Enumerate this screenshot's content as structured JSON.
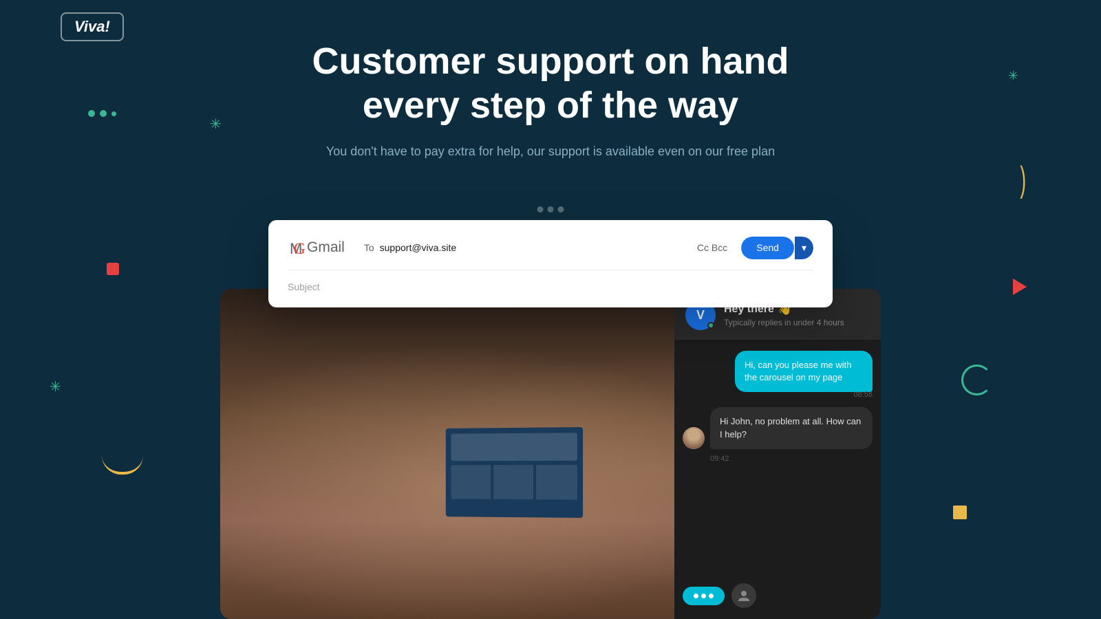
{
  "logo": {
    "text": "Viva!"
  },
  "headline": {
    "title": "Customer support on hand every step of the way",
    "subtitle": "You don't have to pay extra for help, our support is available even on our free plan"
  },
  "email": {
    "to_label": "To",
    "to_value": "support@viva.site",
    "cc_bcc": "Cc  Bcc",
    "send_label": "Send",
    "subject_placeholder": "Subject"
  },
  "chat": {
    "header_name": "Hey there",
    "header_wave": "👋",
    "header_status": "Typically replies in under 4 hours",
    "avatar_letter": "V",
    "message_user": "Hi, can you please me with the carousel on my page",
    "message_time_user": "08:56",
    "message_support": "Hi John, no problem at all. How can I help?",
    "message_time_support": "09:42"
  }
}
